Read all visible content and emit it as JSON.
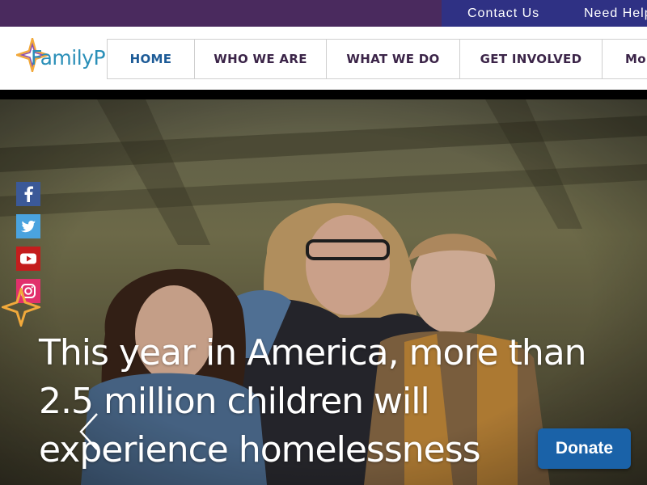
{
  "topbar": {
    "contact_label": "Contact Us",
    "help_label": "Need Help",
    "bg_color": "#4a2a5e",
    "links_bg_color": "#2f3184"
  },
  "logo": {
    "text": "FamilyP",
    "icon": "star-logo-icon"
  },
  "nav": {
    "items": [
      {
        "label": "HOME",
        "active": true
      },
      {
        "label": "WHO WE ARE",
        "active": false
      },
      {
        "label": "WHAT WE DO",
        "active": false
      },
      {
        "label": "GET INVOLVED",
        "active": false
      },
      {
        "label": "More",
        "active": false
      }
    ],
    "active_color": "#1d5b97",
    "text_color": "#3b2448"
  },
  "hero": {
    "headline": "This year in America, more than 2.5 million children will experience homelessness",
    "prev_arrow_icon": "chevron-left-icon"
  },
  "social": [
    {
      "name": "facebook",
      "icon": "facebook-icon",
      "color": "#3b5998"
    },
    {
      "name": "twitter",
      "icon": "twitter-icon",
      "color": "#4aa3df"
    },
    {
      "name": "youtube",
      "icon": "youtube-icon",
      "color": "#c41d1d"
    },
    {
      "name": "instagram",
      "icon": "instagram-icon",
      "color": "#e1306c"
    }
  ],
  "donate": {
    "label": "Donate",
    "color": "#1a62a8"
  }
}
